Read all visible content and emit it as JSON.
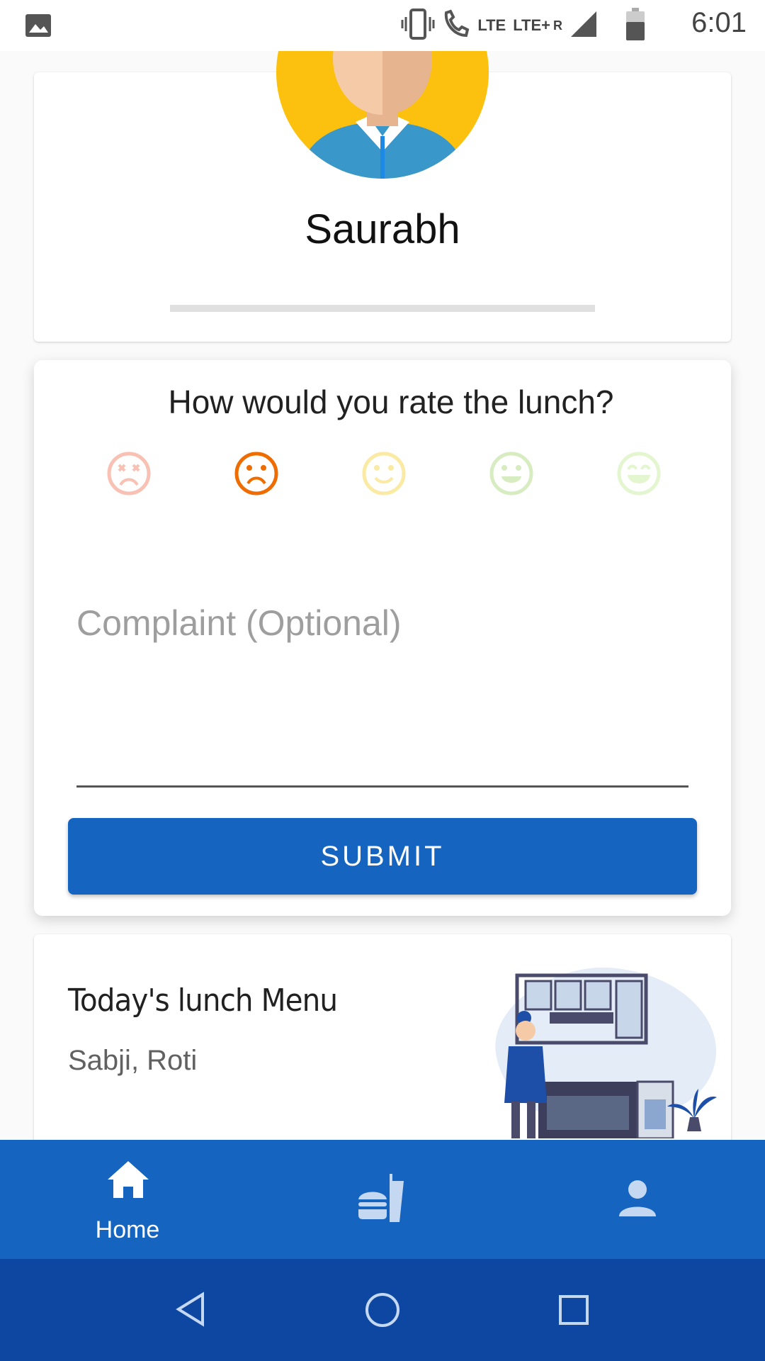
{
  "status_bar": {
    "time": "6:01",
    "network_1": "LTE",
    "network_2": "LTE+",
    "roaming": "R",
    "icons": [
      "image-icon",
      "vibrate-icon",
      "call-icon",
      "signal-icon",
      "battery-icon"
    ]
  },
  "profile": {
    "name": "Saurabh"
  },
  "rating": {
    "question": "How would you rate the lunch?",
    "selected_index": 1,
    "options": [
      {
        "icon": "very-dissatisfied-icon",
        "color": "#f8c1b3"
      },
      {
        "icon": "dissatisfied-icon",
        "color": "#ef6c00"
      },
      {
        "icon": "neutral-icon",
        "color": "#fbeaa4"
      },
      {
        "icon": "satisfied-icon",
        "color": "#d7ecc0"
      },
      {
        "icon": "very-satisfied-icon",
        "color": "#e3f6cf"
      }
    ],
    "complaint_placeholder": "Complaint (Optional)",
    "submit_label": "SUBMIT"
  },
  "menu": {
    "title": "Today's lunch Menu",
    "items": "Sabji, Roti"
  },
  "bottom_nav": {
    "items": [
      {
        "label": "Home",
        "icon": "home-icon",
        "active": true
      },
      {
        "label": "",
        "icon": "fastfood-icon",
        "active": false
      },
      {
        "label": "",
        "icon": "person-icon",
        "active": false
      }
    ]
  },
  "colors": {
    "primary": "#1565c0",
    "primary_dark": "#0d47a1",
    "avatar_bg": "#fcc10f"
  }
}
